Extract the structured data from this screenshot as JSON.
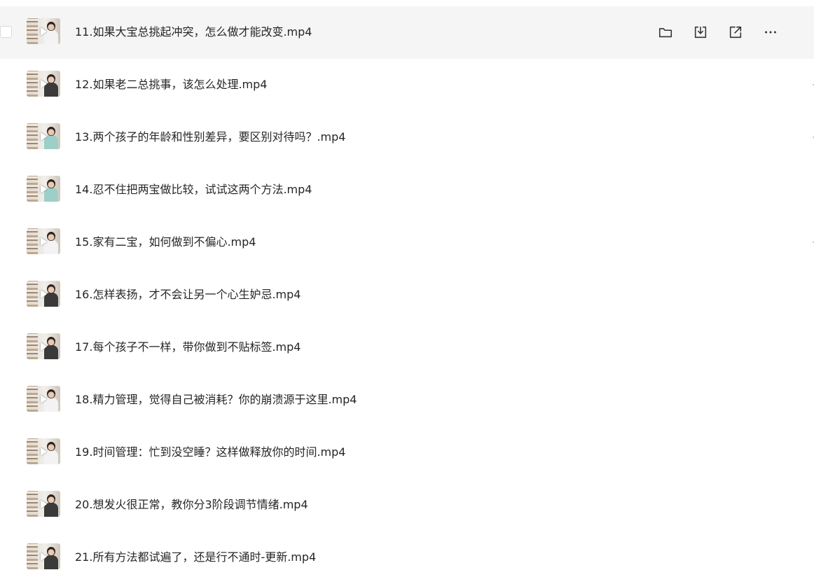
{
  "files": [
    {
      "name": "11.如果大宝总挑起冲突，怎么做才能改变.mp4",
      "hover": true
    },
    {
      "name": "12.如果老二总挑事，该怎么处理.mp4"
    },
    {
      "name": "13.两个孩子的年龄和性别差异，要区别对待吗？.mp4"
    },
    {
      "name": "14.忍不住把两宝做比较，试试这两个方法.mp4"
    },
    {
      "name": "15.家有二宝，如何做到不偏心.mp4"
    },
    {
      "name": "16.怎样表扬，才不会让另一个心生妒忌.mp4"
    },
    {
      "name": "17.每个孩子不一样，带你做到不贴标签.mp4"
    },
    {
      "name": "18.精力管理，觉得自己被消耗？你的崩溃源于这里.mp4"
    },
    {
      "name": "19.时间管理：忙到没空睡？这样做释放你的时间.mp4"
    },
    {
      "name": "20.想发火很正常，教你分3阶段调节情绪.mp4"
    },
    {
      "name": "21.所有方法都试遍了，还是行不通时-更新.mp4"
    }
  ],
  "row_actions": [
    "folder-icon",
    "download-icon",
    "share-icon",
    "more-icon"
  ]
}
